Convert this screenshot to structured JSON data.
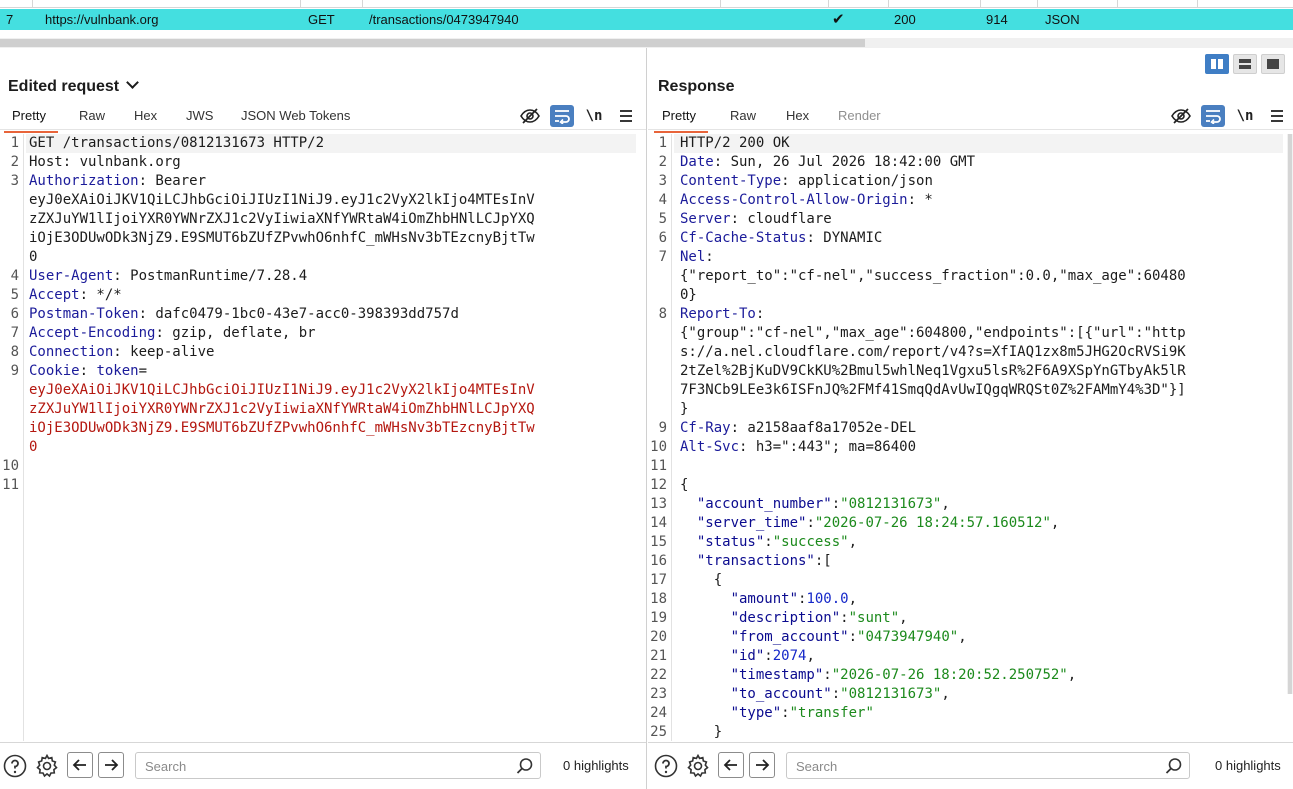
{
  "history": {
    "selected_row": {
      "num": "7",
      "host": "https://vulnbank.org",
      "method": "GET",
      "url": "/transactions/0473947940",
      "check": "✔",
      "status": "200",
      "length": "914",
      "mime": "JSON"
    }
  },
  "request": {
    "title": "Edited request",
    "tabs": [
      "Pretty",
      "Raw",
      "Hex",
      "JWS",
      "JSON Web Tokens"
    ],
    "active_tab": "Pretty",
    "newline_label": "\\n",
    "search_placeholder": "Search",
    "highlights": "0 highlights",
    "lines": [
      {
        "n": "1",
        "segs": [
          {
            "t": "GET /transactions/0812131673 HTTP/2",
            "c": "pun"
          }
        ],
        "hl": true
      },
      {
        "n": "2",
        "segs": [
          {
            "t": "Host: vulnbank.org",
            "c": "pun"
          }
        ]
      },
      {
        "n": "3",
        "segs": [
          {
            "t": "Authorization",
            "c": "hn"
          },
          {
            "t": ": Bearer",
            "c": "pun"
          }
        ]
      },
      {
        "n": "",
        "segs": [
          {
            "t": "eyJ0eXAiOiJKV1QiLCJhbGciOiJIUzI1NiJ9.eyJ1c2VyX2lkIjo4MTEsInV",
            "c": "pun"
          }
        ]
      },
      {
        "n": "",
        "segs": [
          {
            "t": "zZXJuYW1lIjoiYXR0YWNrZXJ1c2VyIiwiaXNfYWRtaW4iOmZhbHNlLCJpYXQ",
            "c": "pun"
          }
        ]
      },
      {
        "n": "",
        "segs": [
          {
            "t": "iOjE3ODUwODk3NjZ9.E9SMUT6bZUfZPvwhO6nhfC_mWHsNv3bTEzcnyBjtTw",
            "c": "pun"
          }
        ]
      },
      {
        "n": "",
        "segs": [
          {
            "t": "0",
            "c": "pun"
          }
        ]
      },
      {
        "n": "4",
        "segs": [
          {
            "t": "User-Agent",
            "c": "hn"
          },
          {
            "t": ": PostmanRuntime/7.28.4",
            "c": "pun"
          }
        ]
      },
      {
        "n": "5",
        "segs": [
          {
            "t": "Accept",
            "c": "hn"
          },
          {
            "t": ": */*",
            "c": "pun"
          }
        ]
      },
      {
        "n": "6",
        "segs": [
          {
            "t": "Postman-Token",
            "c": "hn"
          },
          {
            "t": ": dafc0479-1bc0-43e7-acc0-398393dd757d",
            "c": "pun"
          }
        ]
      },
      {
        "n": "7",
        "segs": [
          {
            "t": "Accept-Encoding",
            "c": "hn"
          },
          {
            "t": ": gzip, deflate, br",
            "c": "pun"
          }
        ]
      },
      {
        "n": "8",
        "segs": [
          {
            "t": "Connection",
            "c": "hn"
          },
          {
            "t": ": keep-alive",
            "c": "pun"
          }
        ]
      },
      {
        "n": "9",
        "segs": [
          {
            "t": "Cookie",
            "c": "hn"
          },
          {
            "t": ": ",
            "c": "pun"
          },
          {
            "t": "token",
            "c": "hn"
          },
          {
            "t": "=",
            "c": "pun"
          }
        ]
      },
      {
        "n": "",
        "segs": [
          {
            "t": "eyJ0eXAiOiJKV1QiLCJhbGciOiJIUzI1NiJ9.eyJ1c2VyX2lkIjo4MTEsInV",
            "c": "red"
          }
        ]
      },
      {
        "n": "",
        "segs": [
          {
            "t": "zZXJuYW1lIjoiYXR0YWNrZXJ1c2VyIiwiaXNfYWRtaW4iOmZhbHNlLCJpYXQ",
            "c": "red"
          }
        ]
      },
      {
        "n": "",
        "segs": [
          {
            "t": "iOjE3ODUwODk3NjZ9.E9SMUT6bZUfZPvwhO6nhfC_mWHsNv3bTEzcnyBjtTw",
            "c": "red"
          }
        ]
      },
      {
        "n": "",
        "segs": [
          {
            "t": "0",
            "c": "red"
          }
        ]
      },
      {
        "n": "10",
        "segs": []
      },
      {
        "n": "11",
        "segs": []
      }
    ]
  },
  "response": {
    "title": "Response",
    "tabs": [
      "Pretty",
      "Raw",
      "Hex",
      "Render"
    ],
    "active_tab": "Pretty",
    "newline_label": "\\n",
    "search_placeholder": "Search",
    "highlights": "0 highlights",
    "lines": [
      {
        "n": "1",
        "segs": [
          {
            "t": "HTTP/2 200 OK",
            "c": "pun"
          }
        ],
        "hl": true
      },
      {
        "n": "2",
        "segs": [
          {
            "t": "Date",
            "c": "hn"
          },
          {
            "t": ": Sun, 26 Jul 2026 18:42:00 GMT",
            "c": "pun"
          }
        ]
      },
      {
        "n": "3",
        "segs": [
          {
            "t": "Content-Type",
            "c": "hn"
          },
          {
            "t": ": application/json",
            "c": "pun"
          }
        ]
      },
      {
        "n": "4",
        "segs": [
          {
            "t": "Access-Control-Allow-Origin",
            "c": "hn"
          },
          {
            "t": ": *",
            "c": "pun"
          }
        ]
      },
      {
        "n": "5",
        "segs": [
          {
            "t": "Server",
            "c": "hn"
          },
          {
            "t": ": cloudflare",
            "c": "pun"
          }
        ]
      },
      {
        "n": "6",
        "segs": [
          {
            "t": "Cf-Cache-Status",
            "c": "hn"
          },
          {
            "t": ": DYNAMIC",
            "c": "pun"
          }
        ]
      },
      {
        "n": "7",
        "segs": [
          {
            "t": "Nel",
            "c": "hn"
          },
          {
            "t": ":",
            "c": "pun"
          }
        ]
      },
      {
        "n": "",
        "segs": [
          {
            "t": "{\"report_to\":\"cf-nel\",\"success_fraction\":0.0,\"max_age\":60480",
            "c": "pun"
          }
        ]
      },
      {
        "n": "",
        "segs": [
          {
            "t": "0}",
            "c": "pun"
          }
        ]
      },
      {
        "n": "8",
        "segs": [
          {
            "t": "Report-To",
            "c": "hn"
          },
          {
            "t": ":",
            "c": "pun"
          }
        ]
      },
      {
        "n": "",
        "segs": [
          {
            "t": "{\"group\":\"cf-nel\",\"max_age\":604800,\"endpoints\":[{\"url\":\"http",
            "c": "pun"
          }
        ]
      },
      {
        "n": "",
        "segs": [
          {
            "t": "s://a.nel.cloudflare.com/report/v4?s=XfIAQ1zx8m5JHG2OcRVSi9K",
            "c": "pun"
          }
        ]
      },
      {
        "n": "",
        "segs": [
          {
            "t": "2tZel%2BjKuDV9CkKU%2Bmul5whlNeq1Vgxu5lsR%2F6A9XSpYnGTbyAk5lR",
            "c": "pun"
          }
        ]
      },
      {
        "n": "",
        "segs": [
          {
            "t": "7F3NCb9LEe3k6ISFnJQ%2FMf41SmqQdAvUwIQgqWRQSt0Z%2FAMmY4%3D\"}]",
            "c": "pun"
          }
        ]
      },
      {
        "n": "",
        "segs": [
          {
            "t": "}",
            "c": "pun"
          }
        ]
      },
      {
        "n": "9",
        "segs": [
          {
            "t": "Cf-Ray",
            "c": "hn"
          },
          {
            "t": ": a2158aaf8a17052e-DEL",
            "c": "pun"
          }
        ]
      },
      {
        "n": "10",
        "segs": [
          {
            "t": "Alt-Svc",
            "c": "hn"
          },
          {
            "t": ": h3=\":443\"; ma=86400",
            "c": "pun"
          }
        ]
      },
      {
        "n": "11",
        "segs": []
      },
      {
        "n": "12",
        "segs": [
          {
            "t": "{",
            "c": "pun"
          }
        ]
      },
      {
        "n": "13",
        "segs": [
          {
            "t": "  ",
            "c": "pun"
          },
          {
            "t": "\"account_number\"",
            "c": "key"
          },
          {
            "t": ":",
            "c": "pun"
          },
          {
            "t": "\"0812131673\"",
            "c": "str"
          },
          {
            "t": ",",
            "c": "pun"
          }
        ]
      },
      {
        "n": "14",
        "segs": [
          {
            "t": "  ",
            "c": "pun"
          },
          {
            "t": "\"server_time\"",
            "c": "key"
          },
          {
            "t": ":",
            "c": "pun"
          },
          {
            "t": "\"2026-07-26 18:24:57.160512\"",
            "c": "str"
          },
          {
            "t": ",",
            "c": "pun"
          }
        ]
      },
      {
        "n": "15",
        "segs": [
          {
            "t": "  ",
            "c": "pun"
          },
          {
            "t": "\"status\"",
            "c": "key"
          },
          {
            "t": ":",
            "c": "pun"
          },
          {
            "t": "\"success\"",
            "c": "str"
          },
          {
            "t": ",",
            "c": "pun"
          }
        ]
      },
      {
        "n": "16",
        "segs": [
          {
            "t": "  ",
            "c": "pun"
          },
          {
            "t": "\"transactions\"",
            "c": "key"
          },
          {
            "t": ":[",
            "c": "pun"
          }
        ]
      },
      {
        "n": "17",
        "segs": [
          {
            "t": "    {",
            "c": "pun"
          }
        ]
      },
      {
        "n": "18",
        "segs": [
          {
            "t": "      ",
            "c": "pun"
          },
          {
            "t": "\"amount\"",
            "c": "key"
          },
          {
            "t": ":",
            "c": "pun"
          },
          {
            "t": "100.0",
            "c": "num"
          },
          {
            "t": ",",
            "c": "pun"
          }
        ]
      },
      {
        "n": "19",
        "segs": [
          {
            "t": "      ",
            "c": "pun"
          },
          {
            "t": "\"description\"",
            "c": "key"
          },
          {
            "t": ":",
            "c": "pun"
          },
          {
            "t": "\"sunt\"",
            "c": "str"
          },
          {
            "t": ",",
            "c": "pun"
          }
        ]
      },
      {
        "n": "20",
        "segs": [
          {
            "t": "      ",
            "c": "pun"
          },
          {
            "t": "\"from_account\"",
            "c": "key"
          },
          {
            "t": ":",
            "c": "pun"
          },
          {
            "t": "\"0473947940\"",
            "c": "str"
          },
          {
            "t": ",",
            "c": "pun"
          }
        ]
      },
      {
        "n": "21",
        "segs": [
          {
            "t": "      ",
            "c": "pun"
          },
          {
            "t": "\"id\"",
            "c": "key"
          },
          {
            "t": ":",
            "c": "pun"
          },
          {
            "t": "2074",
            "c": "num"
          },
          {
            "t": ",",
            "c": "pun"
          }
        ]
      },
      {
        "n": "22",
        "segs": [
          {
            "t": "      ",
            "c": "pun"
          },
          {
            "t": "\"timestamp\"",
            "c": "key"
          },
          {
            "t": ":",
            "c": "pun"
          },
          {
            "t": "\"2026-07-26 18:20:52.250752\"",
            "c": "str"
          },
          {
            "t": ",",
            "c": "pun"
          }
        ]
      },
      {
        "n": "23",
        "segs": [
          {
            "t": "      ",
            "c": "pun"
          },
          {
            "t": "\"to_account\"",
            "c": "key"
          },
          {
            "t": ":",
            "c": "pun"
          },
          {
            "t": "\"0812131673\"",
            "c": "str"
          },
          {
            "t": ",",
            "c": "pun"
          }
        ]
      },
      {
        "n": "24",
        "segs": [
          {
            "t": "      ",
            "c": "pun"
          },
          {
            "t": "\"type\"",
            "c": "key"
          },
          {
            "t": ":",
            "c": "pun"
          },
          {
            "t": "\"transfer\"",
            "c": "str"
          }
        ]
      },
      {
        "n": "25",
        "segs": [
          {
            "t": "    }",
            "c": "pun"
          }
        ]
      }
    ]
  },
  "colors": {
    "selected_row": "#44dfe0",
    "active_tab_underline": "#e8643a",
    "header_name": "#1b1b9a",
    "cookie_value": "#b4170f",
    "json_string": "#1c8a1c",
    "json_number": "#1528c9"
  },
  "icons": {
    "hide": "eye-slash-icon",
    "wrap": "word-wrap-icon",
    "menu": "hamburger-menu-icon",
    "help": "help-circle-icon",
    "settings": "gear-icon",
    "back": "arrow-left-icon",
    "forward": "arrow-right-icon",
    "search": "magnifier-icon",
    "layout": [
      "split-horizontal-icon",
      "split-vertical-icon",
      "single-pane-icon"
    ]
  }
}
